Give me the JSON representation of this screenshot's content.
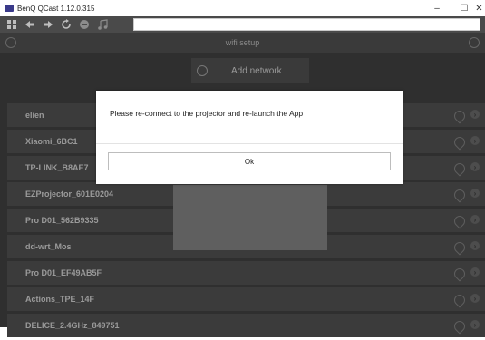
{
  "window": {
    "title": "BenQ QCast 1.12.0.315",
    "controls": {
      "minimize": "–",
      "maximize": "☐",
      "close": "✕"
    }
  },
  "toolbar": {
    "icons": [
      "grid-icon",
      "back-arrow-icon",
      "forward-arrow-icon",
      "refresh-icon",
      "stop-icon",
      "music-icon"
    ],
    "address_value": ""
  },
  "header": {
    "title": "wifi setup"
  },
  "add_network": {
    "label": "Add network"
  },
  "networks": [
    {
      "ssid": "elien"
    },
    {
      "ssid": "Xiaomi_6BC1"
    },
    {
      "ssid": "TP-LINK_B8AE7"
    },
    {
      "ssid": "EZProjector_601E0204"
    },
    {
      "ssid": "Pro D01_562B9335"
    },
    {
      "ssid": "dd-wrt_Mos"
    },
    {
      "ssid": "Pro D01_EF49AB5F"
    },
    {
      "ssid": "Actions_TPE_14F"
    },
    {
      "ssid": "DELICE_2.4GHz_849751"
    }
  ],
  "dialog": {
    "message": "Please re-connect to the projector and  re-launch the App",
    "ok_label": "Ok"
  }
}
